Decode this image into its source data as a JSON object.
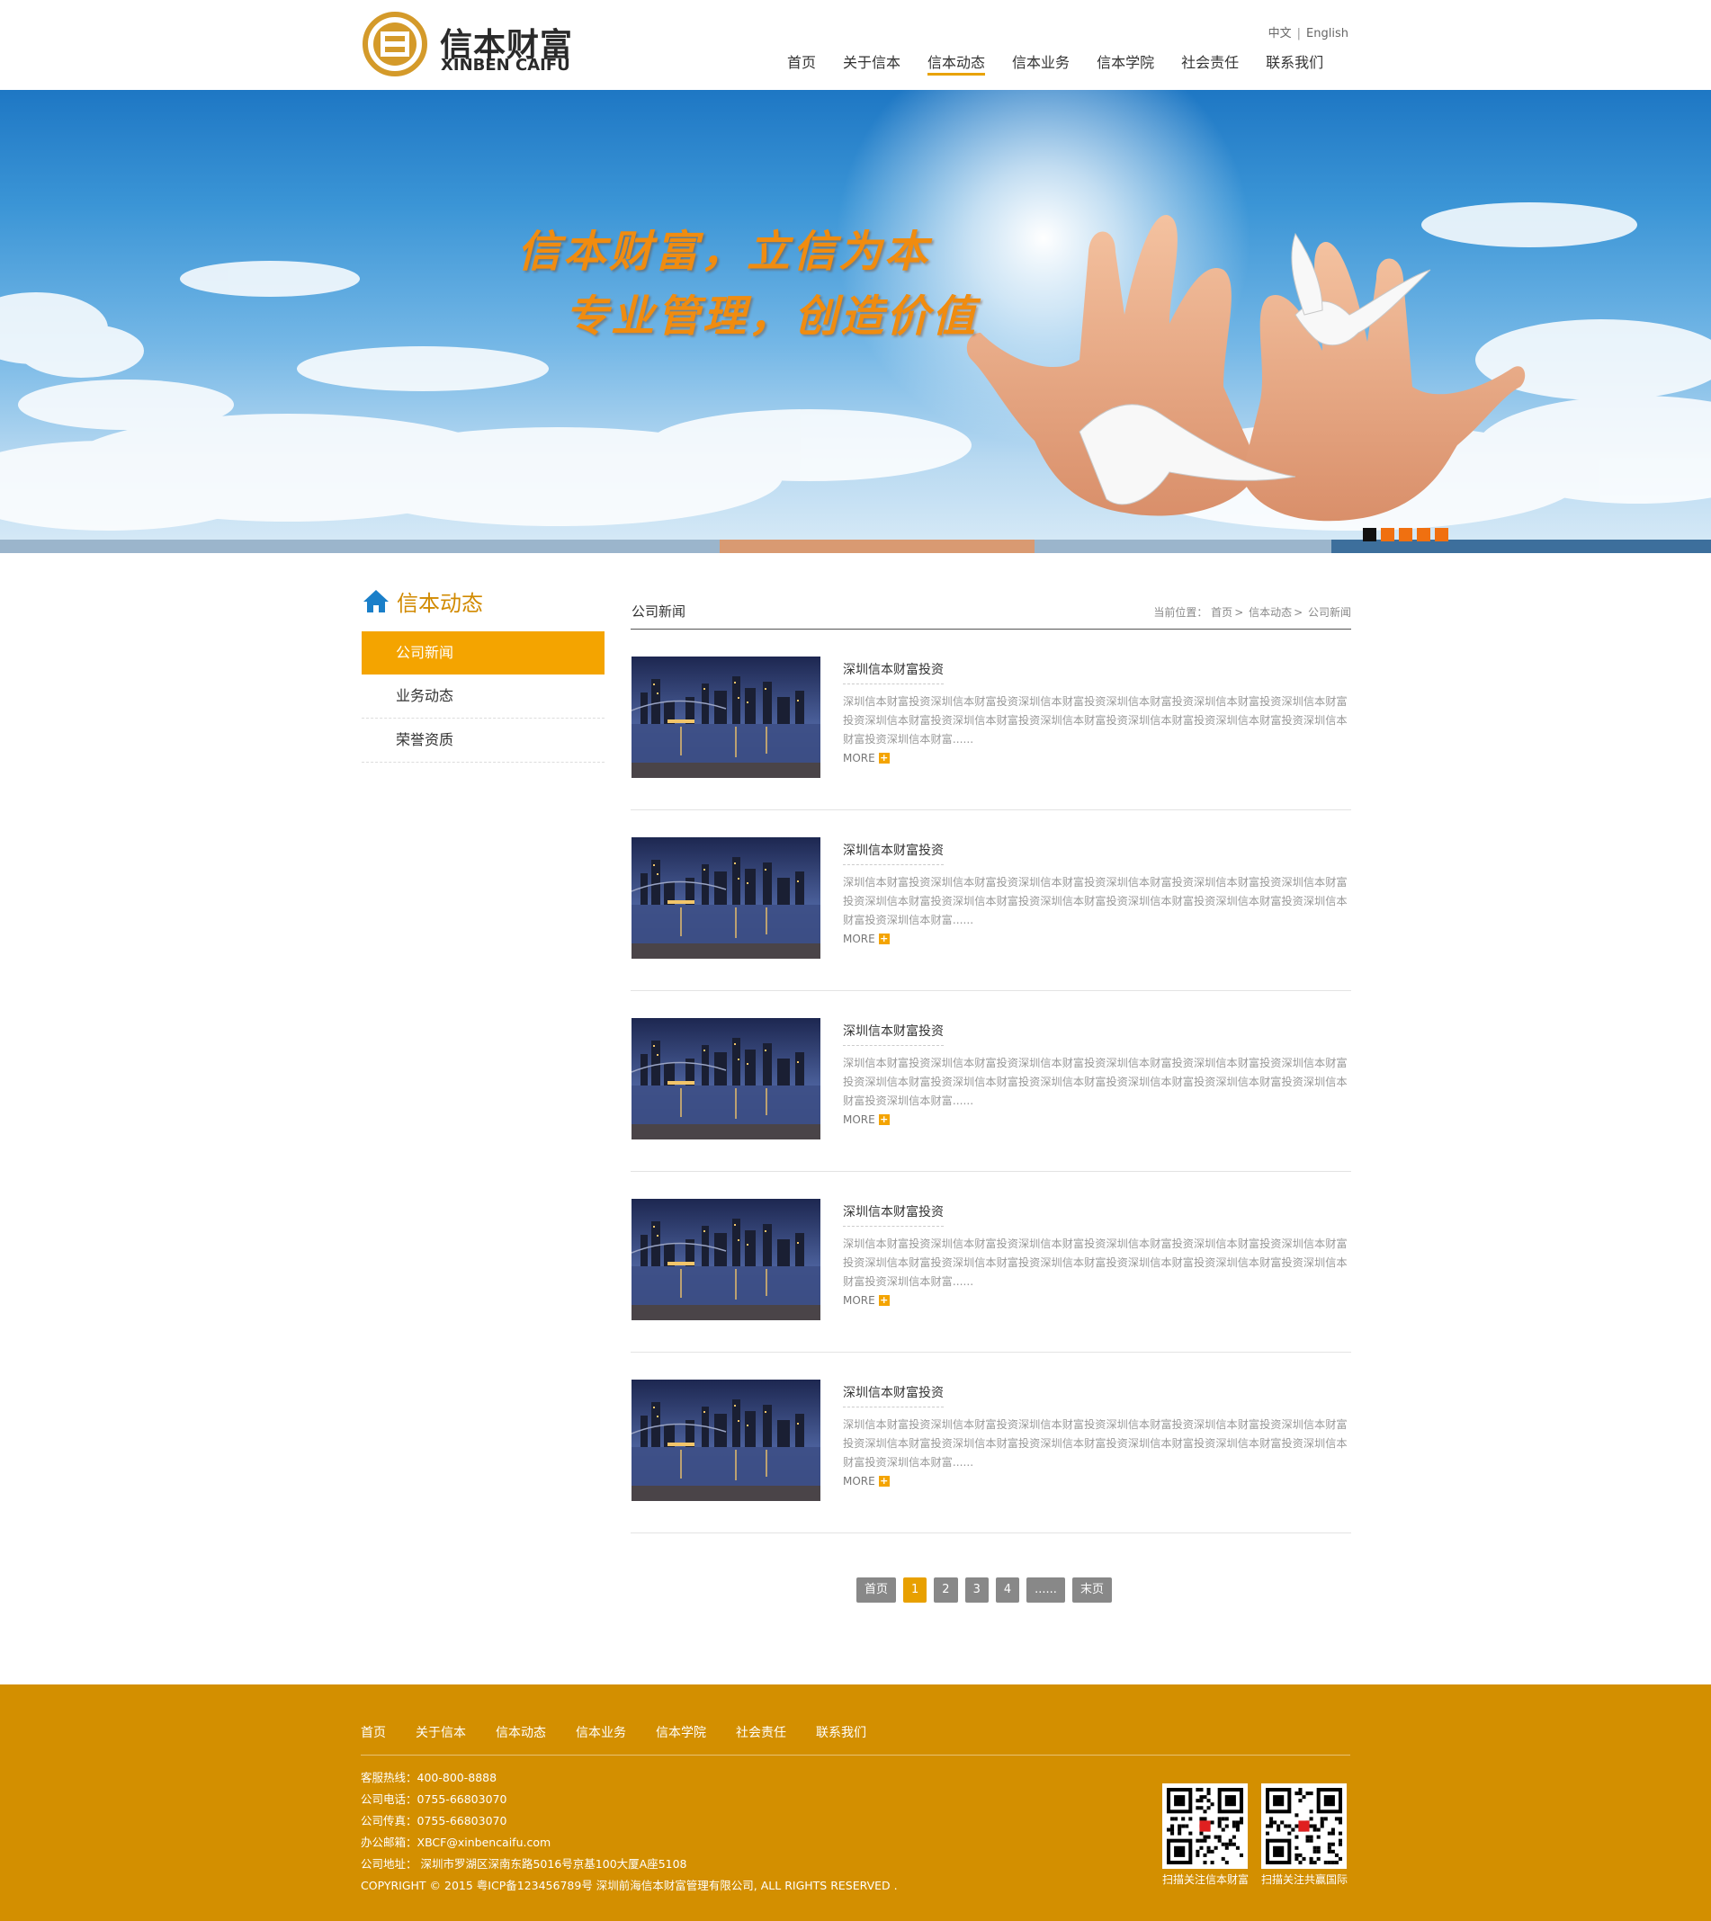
{
  "header": {
    "logo_cn": "信本财富",
    "logo_en": "XINBEN CAIFU",
    "lang": {
      "zh": "中文",
      "en": "English"
    },
    "nav": [
      "首页",
      "关于信本",
      "信本动态",
      "信本业务",
      "信本学院",
      "社会责任",
      "联系我们"
    ],
    "active_nav": "信本动态"
  },
  "banner": {
    "slogan_line1": "信本财富，立信为本",
    "slogan_line2": "专业管理，创造价值",
    "slide_count": 5,
    "active_slide": 1
  },
  "sidebar": {
    "title": "信本动态",
    "items": [
      "公司新闻",
      "业务动态",
      "荣誉资质"
    ],
    "active": "公司新闻"
  },
  "content": {
    "category": "公司新闻",
    "breadcrumb": {
      "prefix": "当前位置：",
      "home": "首页",
      "level1": "信本动态",
      "level2": "公司新闻",
      "sep": ">"
    },
    "news": [
      {
        "title": "深圳信本财富投资",
        "desc": "深圳信本财富投资深圳信本财富投资深圳信本财富投资深圳信本财富投资深圳信本财富投资深圳信本财富投资深圳信本财富投资深圳信本财富投资深圳信本财富投资深圳信本财富投资深圳信本财富投资深圳信本财富投资深圳信本财富......",
        "more": "MORE"
      },
      {
        "title": "深圳信本财富投资",
        "desc": "深圳信本财富投资深圳信本财富投资深圳信本财富投资深圳信本财富投资深圳信本财富投资深圳信本财富投资深圳信本财富投资深圳信本财富投资深圳信本财富投资深圳信本财富投资深圳信本财富投资深圳信本财富投资深圳信本财富......",
        "more": "MORE"
      },
      {
        "title": "深圳信本财富投资",
        "desc": "深圳信本财富投资深圳信本财富投资深圳信本财富投资深圳信本财富投资深圳信本财富投资深圳信本财富投资深圳信本财富投资深圳信本财富投资深圳信本财富投资深圳信本财富投资深圳信本财富投资深圳信本财富投资深圳信本财富......",
        "more": "MORE"
      },
      {
        "title": "深圳信本财富投资",
        "desc": "深圳信本财富投资深圳信本财富投资深圳信本财富投资深圳信本财富投资深圳信本财富投资深圳信本财富投资深圳信本财富投资深圳信本财富投资深圳信本财富投资深圳信本财富投资深圳信本财富投资深圳信本财富投资深圳信本财富......",
        "more": "MORE"
      },
      {
        "title": "深圳信本财富投资",
        "desc": "深圳信本财富投资深圳信本财富投资深圳信本财富投资深圳信本财富投资深圳信本财富投资深圳信本财富投资深圳信本财富投资深圳信本财富投资深圳信本财富投资深圳信本财富投资深圳信本财富投资深圳信本财富投资深圳信本财富......",
        "more": "MORE"
      }
    ]
  },
  "pager": {
    "first": "首页",
    "pages": [
      "1",
      "2",
      "3",
      "4"
    ],
    "ellipsis": "......",
    "last": "末页",
    "current": "1"
  },
  "footer": {
    "nav": [
      "首页",
      "关于信本",
      "信本动态",
      "信本业务",
      "信本学院",
      "社会责任",
      "联系我们"
    ],
    "hotline": "客服热线：400-800-8888",
    "phone": "公司电话：0755-66803070",
    "fax": "公司传真：0755-66803070",
    "email": "办公邮箱：XBCF@xinbencaifu.com",
    "address": "公司地址： 深圳市罗湖区深南东路5016号京基100大厦A座5108",
    "copyright": "COPYRIGHT © 2015 粤ICP备123456789号 深圳前海信本财富管理有限公司, ALL RIGHTS RESERVED .",
    "qr1_caption": "扫描关注信本财富",
    "qr2_caption": "扫描关注共赢国际"
  },
  "colors": {
    "accent": "#f4a400",
    "footer": "#d38f00",
    "nav_underline": "#e8a200",
    "sidebar_icon": "#1a7fc9"
  },
  "icons": {
    "home": "home-icon",
    "more": "plus-icon",
    "logo": "logo-mark-icon"
  }
}
